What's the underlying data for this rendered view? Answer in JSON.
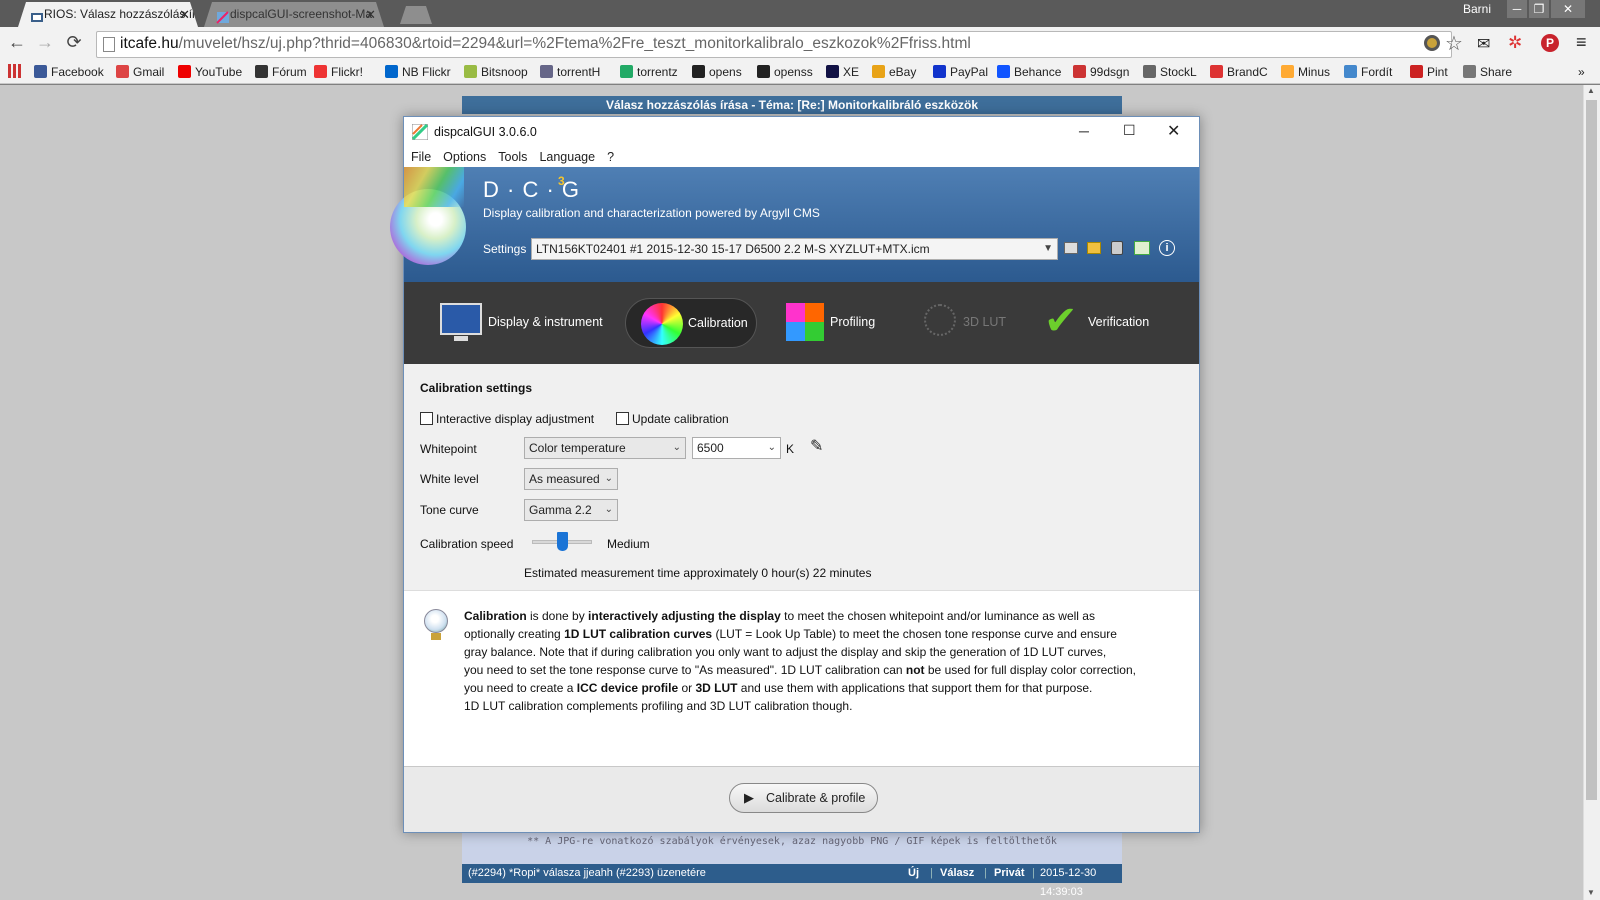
{
  "browser": {
    "tabs": [
      {
        "label": "RIOS: Válasz hozzászólás ír",
        "active": true
      },
      {
        "label": "dispcalGUI-screenshot-Ma",
        "active": false
      }
    ],
    "user": "Barni",
    "url_host": "itcafe.hu",
    "url_path": "/muvelet/hsz/uj.php?thrid=406830&rtoid=2294&url=%2Ftema%2Fre_teszt_monitorkalibralo_eszkozok%2Ffriss.html",
    "bookmarks": [
      "Facebook",
      "Gmail",
      "YouTube",
      "Fórum",
      "Flickr!",
      "NB Flickr",
      "Bitsnoop",
      "torrentH",
      "torrentz",
      "opens",
      "openss",
      "XE",
      "eBay",
      "PayPal",
      "Behance",
      "99dsgn",
      "StockL",
      "BrandC",
      "Minus",
      "Fordít",
      "Pint",
      "Share"
    ],
    "overflow": "»"
  },
  "forum": {
    "header": "Válasz hozzászólás írása - Téma: [Re:] Monitorkalibráló eszközök",
    "note": "** A JPG-re vonatkozó szabályok érvényesek, azaz nagyobb PNG / GIF képek is feltölthetők",
    "reply_line": "(#2294) *Ropi* válasza jjeahh (#2293) üzenetére",
    "actions": [
      "Új",
      "Válasz",
      "Privát"
    ],
    "timestamp": "2015-12-30 14:39:03"
  },
  "app": {
    "title": "dispcalGUI 3.0.6.0",
    "menu": [
      "File",
      "Options",
      "Tools",
      "Language",
      "?"
    ],
    "logo": "D · C · G",
    "logo_sup": "3",
    "tagline": "Display calibration and characterization powered by Argyll CMS",
    "settings_label": "Settings",
    "settings_value": "LTN156KT02401 #1 2015-12-30 15-17 D6500 2.2 M-S XYZLUT+MTX.icm",
    "tabs": [
      {
        "label": "Display & instrument",
        "active": false,
        "disabled": false
      },
      {
        "label": "Calibration",
        "active": true,
        "disabled": false
      },
      {
        "label": "Profiling",
        "active": false,
        "disabled": false
      },
      {
        "label": "3D LUT",
        "active": false,
        "disabled": true
      },
      {
        "label": "Verification",
        "active": false,
        "disabled": false
      }
    ],
    "calibration": {
      "heading": "Calibration settings",
      "interactive_label": "Interactive display adjustment",
      "interactive_checked": false,
      "update_label": "Update calibration",
      "update_checked": false,
      "whitepoint_label": "Whitepoint",
      "whitepoint_mode": "Color temperature",
      "whitepoint_value": "6500",
      "whitepoint_unit": "K",
      "white_level_label": "White level",
      "white_level_value": "As measured",
      "tone_curve_label": "Tone curve",
      "tone_curve_value": "Gamma 2.2",
      "speed_label": "Calibration speed",
      "speed_value": "Medium",
      "speed_fraction": 0.5,
      "estimate": "Estimated measurement time approximately 0 hour(s) 22 minutes"
    },
    "info_lines": [
      [
        {
          "t": "Calibration",
          "b": true
        },
        {
          "t": " is done by "
        },
        {
          "t": "interactively adjusting the display",
          "b": true
        },
        {
          "t": " to meet the chosen whitepoint and/or luminance as well as"
        }
      ],
      [
        {
          "t": "optionally creating "
        },
        {
          "t": "1D LUT calibration curves",
          "b": true
        },
        {
          "t": " (LUT = Look Up Table) to meet the chosen tone response curve and ensure"
        }
      ],
      [
        {
          "t": "gray balance. Note that if during calibration you only want to adjust the display and skip the generation of 1D LUT curves,"
        }
      ],
      [
        {
          "t": "you need to set the tone response curve to \"As measured\". 1D LUT calibration can "
        },
        {
          "t": "not",
          "b": true
        },
        {
          "t": " be used for full display color correction,"
        }
      ],
      [
        {
          "t": "you need to create a "
        },
        {
          "t": "ICC device profile",
          "b": true
        },
        {
          "t": " or "
        },
        {
          "t": "3D LUT",
          "b": true
        },
        {
          "t": " and use them with applications that support them for that purpose."
        }
      ],
      [
        {
          "t": "1D LUT calibration complements profiling and 3D LUT calibration though."
        }
      ]
    ],
    "action_button": "Calibrate & profile"
  }
}
